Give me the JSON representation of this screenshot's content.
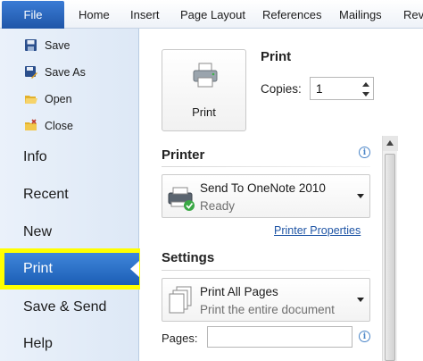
{
  "ribbon": {
    "file_tab": "File",
    "tabs": [
      "Home",
      "Insert",
      "Page Layout",
      "References",
      "Mailings",
      "Revi"
    ]
  },
  "nav": {
    "small_items": [
      {
        "label": "Save",
        "icon": "save-icon"
      },
      {
        "label": "Save As",
        "icon": "save-as-icon"
      },
      {
        "label": "Open",
        "icon": "open-folder-icon"
      },
      {
        "label": "Close",
        "icon": "close-folder-icon"
      }
    ],
    "big_items": [
      {
        "label": "Info"
      },
      {
        "label": "Recent"
      },
      {
        "label": "New"
      },
      {
        "label": "Print",
        "active": true
      },
      {
        "label": "Save & Send"
      },
      {
        "label": "Help"
      }
    ]
  },
  "print_panel": {
    "print_button": "Print",
    "heading": "Print",
    "copies_label": "Copies:",
    "copies_value": "1"
  },
  "printer": {
    "heading": "Printer",
    "name": "Send To OneNote 2010",
    "status": "Ready",
    "properties_link": "Printer Properties"
  },
  "settings": {
    "heading": "Settings",
    "pages_option": "Print All Pages",
    "pages_option_desc": "Print the entire document",
    "pages_label": "Pages:",
    "pages_value": ""
  },
  "colors": {
    "accent": "#1f56a8",
    "highlight": "#ffff00",
    "link": "#1f55a5"
  }
}
